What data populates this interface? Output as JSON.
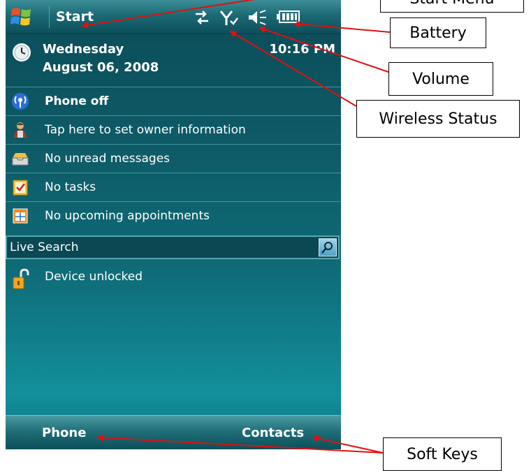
{
  "titlebar": {
    "start_label": "Start"
  },
  "today": {
    "weekday": "Wednesday",
    "date": "August 06, 2008",
    "time": "10:16 PM"
  },
  "items": [
    {
      "label": "Phone off",
      "icon": "phone-signal-icon"
    },
    {
      "label": "Tap here to set owner information",
      "icon": "owner-icon"
    },
    {
      "label": "No unread messages",
      "icon": "inbox-icon"
    },
    {
      "label": "No tasks",
      "icon": "tasks-icon"
    },
    {
      "label": "No upcoming appointments",
      "icon": "calendar-icon"
    }
  ],
  "search": {
    "label": "Live Search"
  },
  "lock": {
    "label": "Device unlocked"
  },
  "softkeys": {
    "left": "Phone",
    "right": "Contacts"
  },
  "callouts": {
    "start_menu": "Start Menu",
    "battery": "Battery",
    "volume": "Volume",
    "wireless": "Wireless Status",
    "soft_keys": "Soft Keys"
  },
  "colors": {
    "screen": "#0e5c68",
    "arrow": "#e01010"
  }
}
